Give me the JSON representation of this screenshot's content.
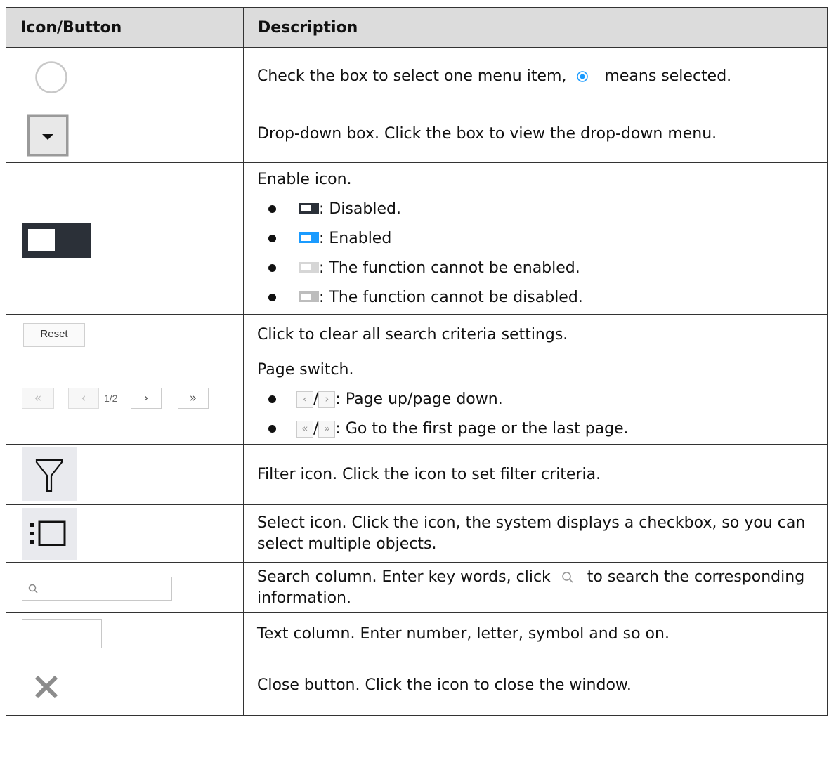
{
  "headers": {
    "col1": "Icon/Button",
    "col2": "Description"
  },
  "rows": {
    "radio": {
      "desc_before": "Check the box to select one menu item,",
      "desc_after": "means selected."
    },
    "dropdown": {
      "desc": "Drop-down box. Click the box to view the drop-down menu."
    },
    "toggle": {
      "title": "Enable icon.",
      "items": [
        {
          "text": ": Disabled."
        },
        {
          "text": ": Enabled"
        },
        {
          "text": ": The function cannot be enabled."
        },
        {
          "text": ": The function cannot be disabled."
        }
      ]
    },
    "reset": {
      "button_label": "Reset",
      "desc": "Click to clear all search criteria settings."
    },
    "pager": {
      "page_indicator": "1/2",
      "first_glyph": "«",
      "prev_glyph": "‹",
      "next_glyph": "›",
      "last_glyph": "»",
      "title": "Page switch.",
      "item1": ": Page up/page down.",
      "item2": ": Go to the first page or the last page.",
      "slash": "/"
    },
    "filter": {
      "desc": "Filter icon. Click the icon to set filter criteria."
    },
    "select": {
      "desc": "Select icon. Click the icon, the system displays a checkbox, so you can select multiple objects."
    },
    "search": {
      "desc_before": "Search column. Enter key words, click",
      "desc_after": "to search the corresponding information."
    },
    "text": {
      "desc": "Text column. Enter number, letter, symbol and so on."
    },
    "close": {
      "desc": "Close button. Click the icon to close the window."
    }
  },
  "colors": {
    "toggle_dark": "#2b3038",
    "toggle_blue": "#1a9bff",
    "toggle_light": "#d6d6d6",
    "toggle_mid": "#bdbdbd",
    "radio_blue": "#1a9bff"
  }
}
